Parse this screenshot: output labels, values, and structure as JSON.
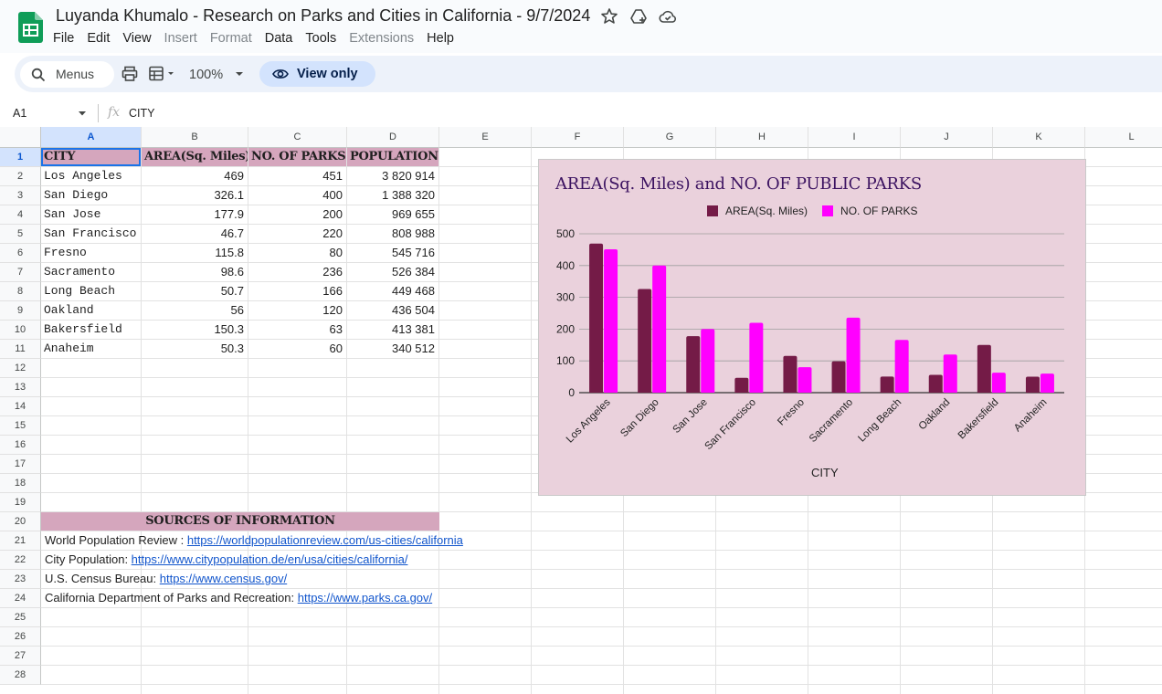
{
  "app": {
    "doc_title": "Luyanda Khumalo - Research on Parks and Cities in California - 9/7/2024",
    "menus": [
      {
        "label": "File",
        "enabled": true
      },
      {
        "label": "Edit",
        "enabled": true
      },
      {
        "label": "View",
        "enabled": true
      },
      {
        "label": "Insert",
        "enabled": false
      },
      {
        "label": "Format",
        "enabled": false
      },
      {
        "label": "Data",
        "enabled": true
      },
      {
        "label": "Tools",
        "enabled": true
      },
      {
        "label": "Extensions",
        "enabled": false
      },
      {
        "label": "Help",
        "enabled": true
      }
    ]
  },
  "toolbar": {
    "search_label": "Menus",
    "zoom": "100%",
    "view_only_label": "View only"
  },
  "formula_bar": {
    "cell_ref": "A1",
    "content": "CITY"
  },
  "grid": {
    "columns": [
      "A",
      "B",
      "C",
      "D",
      "E",
      "F",
      "G",
      "H",
      "I",
      "J",
      "K",
      "L"
    ],
    "row_numbers": [
      "1",
      "2",
      "3",
      "4",
      "5",
      "6",
      "7",
      "8",
      "9",
      "10",
      "11",
      "12",
      "13",
      "14",
      "15",
      "16",
      "17",
      "18",
      "19",
      "20",
      "21",
      "22",
      "23",
      "24",
      "25",
      "26",
      "27",
      "28"
    ],
    "selected_cell": "A1"
  },
  "table": {
    "headers": [
      "CITY",
      "AREA(Sq. Miles)",
      "NO. OF PARKS",
      "POPULATION"
    ],
    "rows": [
      [
        "Los Angeles",
        "469",
        "451",
        "3 820 914"
      ],
      [
        "San Diego",
        "326.1",
        "400",
        "1 388 320"
      ],
      [
        "San Jose",
        "177.9",
        "200",
        "969 655"
      ],
      [
        "San Francisco",
        "46.7",
        "220",
        "808 988"
      ],
      [
        "Fresno",
        "115.8",
        "80",
        "545 716"
      ],
      [
        "Sacramento",
        "98.6",
        "236",
        "526 384"
      ],
      [
        "Long Beach",
        "50.7",
        "166",
        "449 468"
      ],
      [
        "Oakland",
        "56",
        "120",
        "436 504"
      ],
      [
        "Bakersfield",
        "150.3",
        "63",
        "413 381"
      ],
      [
        "Anaheim",
        "50.3",
        "60",
        "340 512"
      ]
    ]
  },
  "sources": {
    "heading": "SOURCES OF INFORMATION",
    "items": [
      {
        "label": "World Population Review : ",
        "url": "https://worldpopulationreview.com/us-cities/california"
      },
      {
        "label": "City Population: ",
        "url": "https://www.citypopulation.de/en/usa/cities/california/"
      },
      {
        "label": "U.S. Census Bureau: ",
        "url": "https://www.census.gov/"
      },
      {
        "label": "California Department of Parks and Recreation: ",
        "url": "https://www.parks.ca.gov/"
      }
    ]
  },
  "chart_data": {
    "type": "bar",
    "title": "AREA(Sq. Miles) and NO. OF PUBLIC PARKS",
    "xlabel": "CITY",
    "ylabel": "",
    "ylim": [
      0,
      500
    ],
    "yticks": [
      0,
      100,
      200,
      300,
      400,
      500
    ],
    "grid": true,
    "legend_position": "top",
    "categories": [
      "Los Angeles",
      "San Diego",
      "San Jose",
      "San Francisco",
      "Fresno",
      "Sacramento",
      "Long Beach",
      "Oakland",
      "Bakersfield",
      "Anaheim"
    ],
    "series": [
      {
        "name": "AREA(Sq. Miles)",
        "color": "#741b47",
        "values": [
          469,
          326.1,
          177.9,
          46.7,
          115.8,
          98.6,
          50.7,
          56,
          150.3,
          50.3
        ]
      },
      {
        "name": "NO. OF PARKS",
        "color": "#ff00ff",
        "values": [
          451,
          400,
          200,
          220,
          80,
          236,
          166,
          120,
          63,
          60
        ]
      }
    ],
    "background": "#ead1dc"
  }
}
